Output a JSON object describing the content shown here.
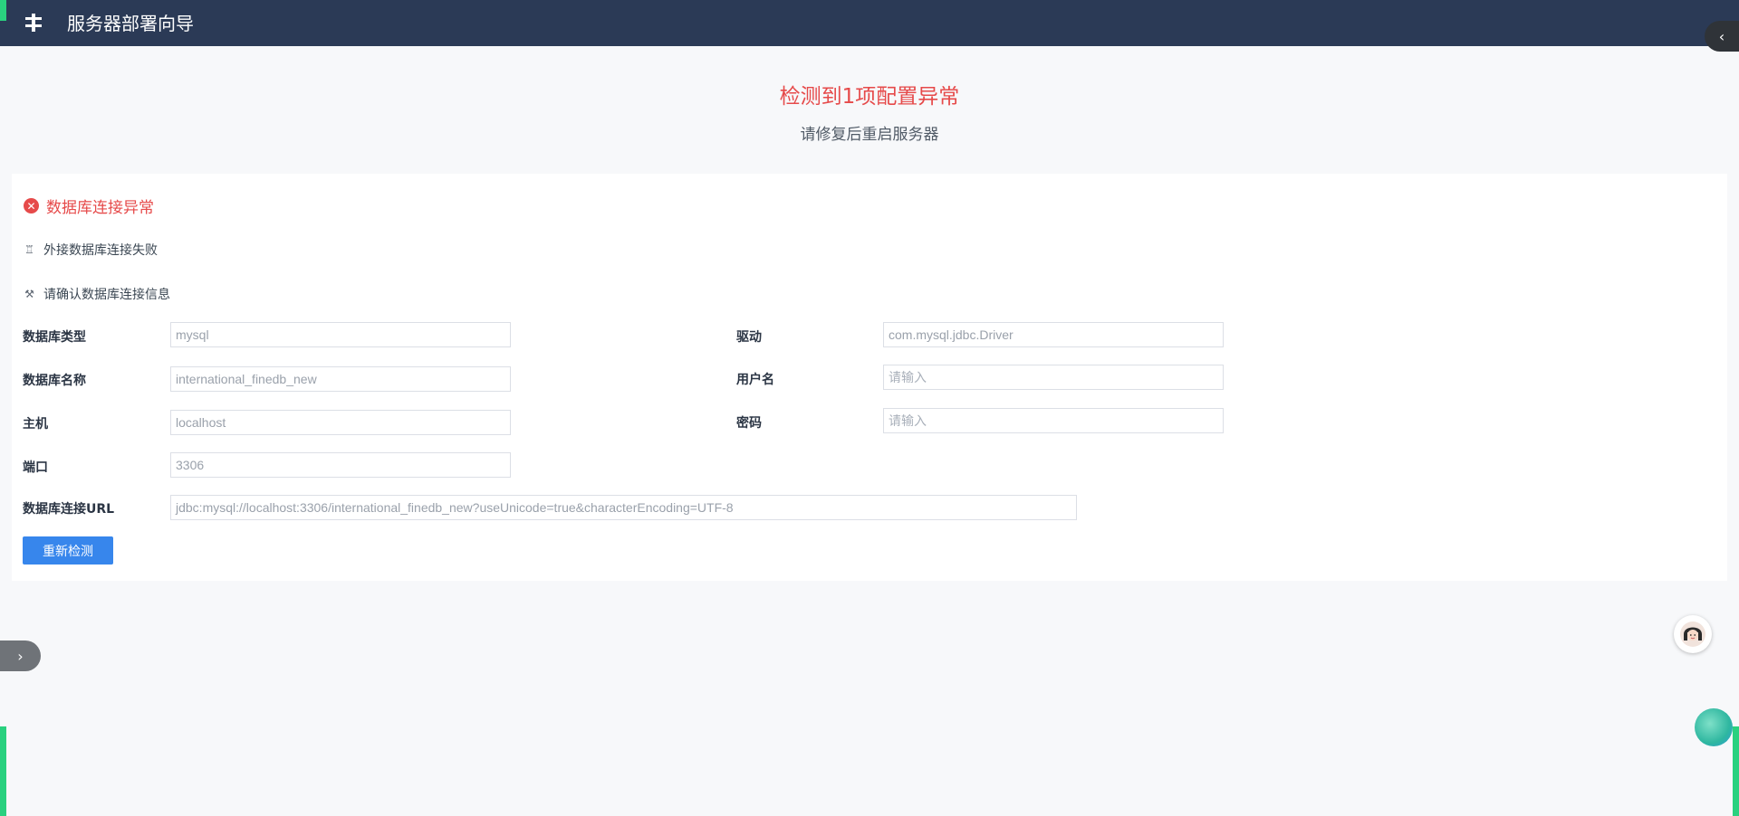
{
  "header": {
    "title": "服务器部署向导"
  },
  "status": {
    "heading": "检测到1项配置异常",
    "subheading": "请修复后重启服务器"
  },
  "error_panel": {
    "title": "数据库连接异常",
    "hint_failure": "外接数据库连接失败",
    "hint_confirm": "请确认数据库连接信息",
    "fields": {
      "db_type": {
        "label": "数据库类型",
        "value": "mysql"
      },
      "driver": {
        "label": "驱动",
        "value": "com.mysql.jdbc.Driver"
      },
      "db_name": {
        "label": "数据库名称",
        "value": "international_finedb_new"
      },
      "username": {
        "label": "用户名",
        "placeholder": "请输入"
      },
      "host": {
        "label": "主机",
        "value": "localhost"
      },
      "password": {
        "label": "密码",
        "placeholder": "请输入"
      },
      "port": {
        "label": "端口",
        "value": "3306"
      },
      "url": {
        "label": "数据库连接URL",
        "value": "jdbc:mysql://localhost:3306/international_finedb_new?useUnicode=true&characterEncoding=UTF-8"
      }
    },
    "retry_button": "重新检测"
  },
  "colors": {
    "header_bg": "#2b3a56",
    "error": "#e64a4a",
    "primary": "#3786ec",
    "accent_green": "#2ad17f"
  }
}
